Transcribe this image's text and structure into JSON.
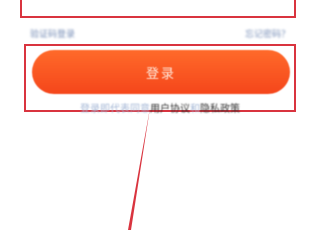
{
  "links": {
    "left": "验证码登录",
    "right": "忘记密码？"
  },
  "login_button": {
    "label": "登录"
  },
  "agreement": {
    "prefix": "登录即代表同意",
    "user_agreement": "用户协议",
    "separator": "和",
    "privacy_policy": "隐私政策"
  },
  "colors": {
    "accent": "#f5461b",
    "highlight": "#d9343f",
    "link": "#7a90b8"
  }
}
